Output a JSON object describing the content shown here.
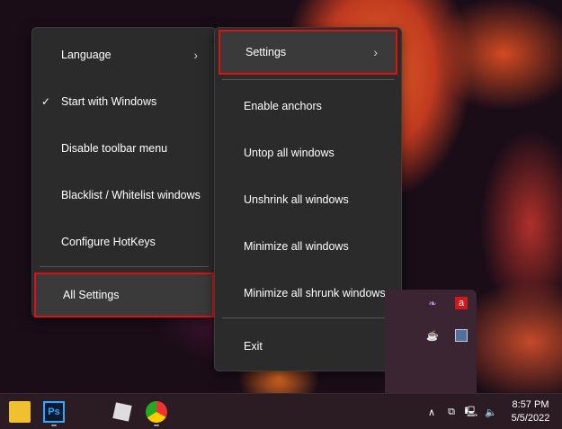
{
  "left_menu": {
    "items": [
      {
        "label": "Language",
        "submenu": true
      },
      {
        "label": "Start with Windows",
        "checked": true
      },
      {
        "label": "Disable toolbar menu"
      },
      {
        "label": "Blacklist / Whitelist windows"
      },
      {
        "label": "Configure HotKeys"
      }
    ],
    "all_settings": "All Settings"
  },
  "right_menu": {
    "settings": "Settings",
    "items": [
      "Enable anchors",
      "Untop all windows",
      "Unshrink all windows",
      "Minimize all windows",
      "Minimize all shrunk windows"
    ],
    "exit": "Exit"
  },
  "taskbar": {
    "photoshop_label": "Ps",
    "time": "8:57 PM",
    "date": "5/5/2022"
  },
  "colors": {
    "highlight_border": "#e01010",
    "menu_bg": "#2b2b2b"
  }
}
